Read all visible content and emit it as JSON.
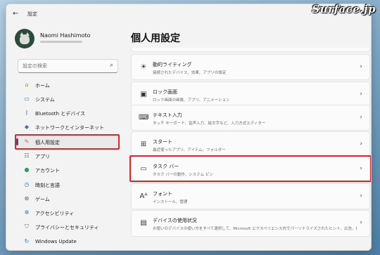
{
  "watermark": "Surface.jp",
  "window": {
    "title": "設定"
  },
  "user": {
    "name": "Naomi Hashimoto"
  },
  "search": {
    "placeholder": "設定の検索"
  },
  "sidebar": {
    "items": [
      {
        "label": "ホーム",
        "icon": "home-icon",
        "glyph": "⌂"
      },
      {
        "label": "システム",
        "icon": "system-icon",
        "glyph": "▭"
      },
      {
        "label": "Bluetooth とデバイス",
        "icon": "bluetooth-icon",
        "glyph": "ᛒ"
      },
      {
        "label": "ネットワークとインターネット",
        "icon": "network-icon",
        "glyph": "◆"
      },
      {
        "label": "個人用設定",
        "icon": "brush-icon",
        "glyph": "✎"
      },
      {
        "label": "アプリ",
        "icon": "apps-icon",
        "glyph": "☷"
      },
      {
        "label": "アカウント",
        "icon": "account-icon",
        "glyph": "●"
      },
      {
        "label": "時刻と言語",
        "icon": "time-language-icon",
        "glyph": "◷"
      },
      {
        "label": "ゲーム",
        "icon": "gaming-icon",
        "glyph": "⊛"
      },
      {
        "label": "アクセシビリティ",
        "icon": "accessibility-icon",
        "glyph": "✲"
      },
      {
        "label": "プライバシーとセキュリティ",
        "icon": "shield-icon",
        "glyph": "⛉"
      },
      {
        "label": "Windows Update",
        "icon": "update-icon",
        "glyph": "↻"
      }
    ]
  },
  "main": {
    "title": "個人用設定",
    "cards": [
      {
        "title": "動的ライティング",
        "subtitle": "接続されたデバイス、効果、アプリの設定",
        "icon": "lighting-icon",
        "glyph": "☀"
      },
      {
        "title": "ロック画面",
        "subtitle": "ロック画面の画像、アプリ、アニメーション",
        "icon": "lock-screen-icon",
        "glyph": "▣"
      },
      {
        "title": "テキスト入力",
        "subtitle": "タッチ キーボード、音声入力、絵文字など、入力方式エディター",
        "icon": "keyboard-icon",
        "glyph": "⌨"
      },
      {
        "title": "スタート",
        "subtitle": "最近使ったアプリ、アイテム、フォルダー",
        "icon": "start-icon",
        "glyph": "⊞"
      },
      {
        "title": "タスク バー",
        "subtitle": "タスク バーの動作、システム ピン",
        "icon": "taskbar-icon",
        "glyph": "▭"
      },
      {
        "title": "フォント",
        "subtitle": "インストール、管理",
        "icon": "font-icon",
        "glyph": "Aᴬ"
      },
      {
        "title": "デバイスの使用状況",
        "subtitle": "お使いのデバイスの使い方をすべて選択して、Microsoft エクスペリエンス内でパーソナライズされたヒント、広告、推奨事項を取得します。",
        "icon": "device-usage-icon",
        "glyph": "▤"
      }
    ]
  }
}
